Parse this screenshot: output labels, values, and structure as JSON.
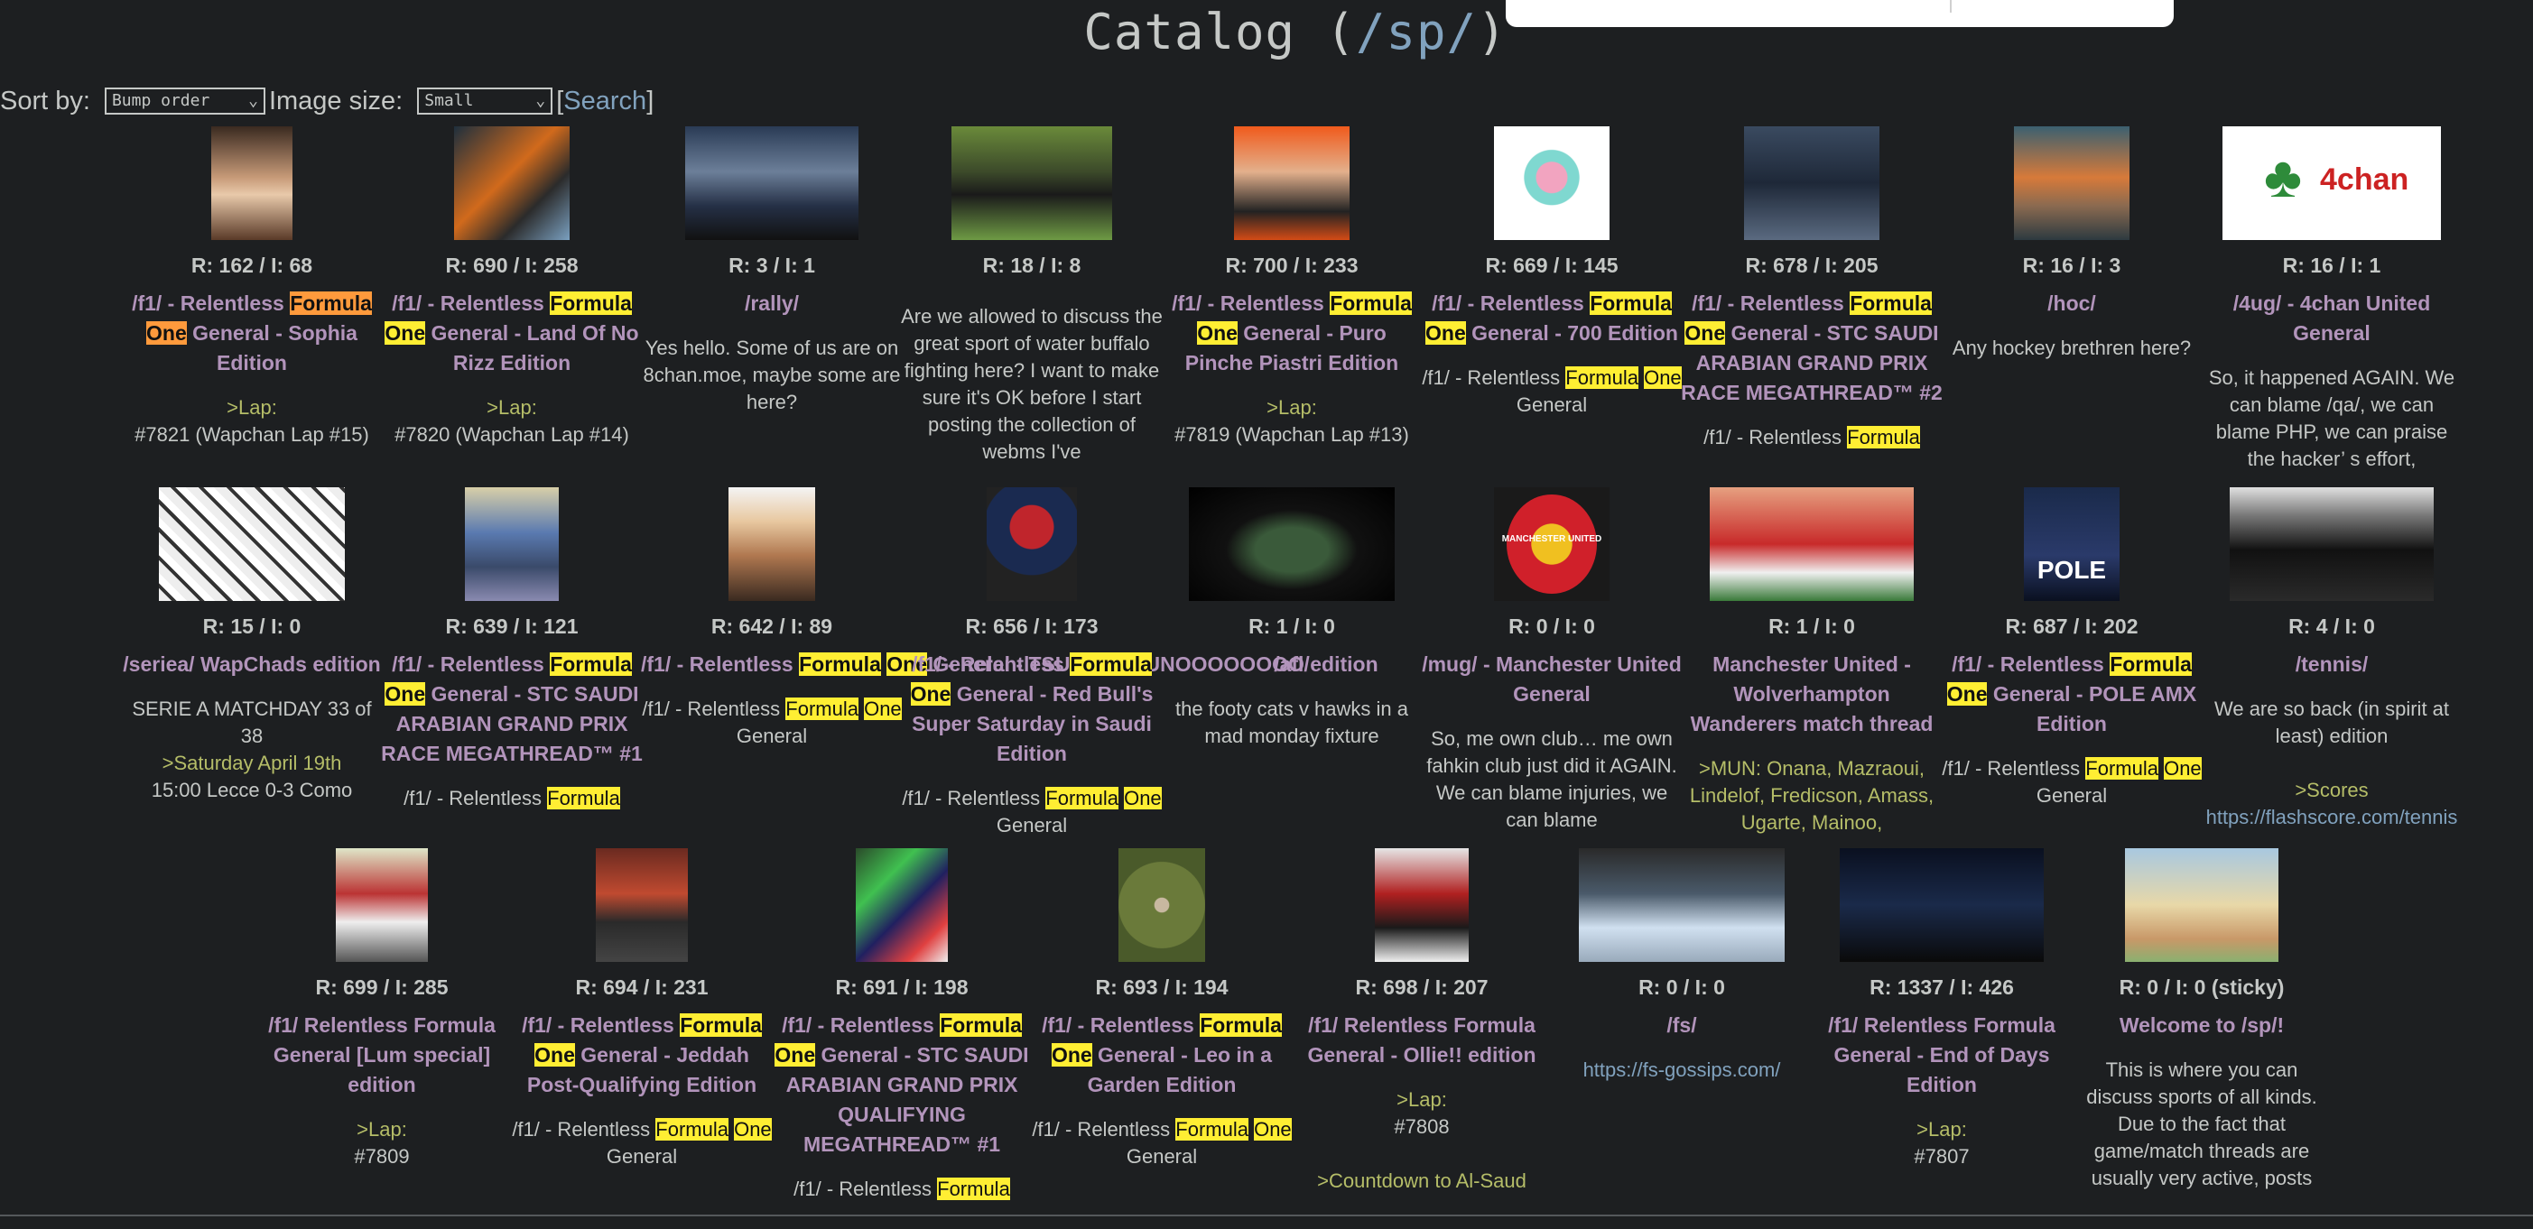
{
  "page": {
    "title_prefix": "Catalog (",
    "board": "/sp/",
    "title_suffix": ")"
  },
  "controls": {
    "sort_label": "Sort by:",
    "sort_value": "Bump order",
    "size_label": "Image size:",
    "size_value": "Small",
    "search_open": "[",
    "search_label": "Search",
    "search_close": "]"
  },
  "threads": [
    {
      "stats": "R: 162 / I: 68",
      "pre": "/f1/ - Relentless ",
      "hl1": "Formula",
      "mid": " ",
      "hl2": "One",
      "post": " General - Sophia Edition",
      "body": "",
      "body_green": ">Lap:",
      "body2": "#7821 (Wapchan Lap #15)",
      "hlcolor": "orange"
    },
    {
      "stats": "R: 690 / I: 258",
      "pre": "/f1/ - Relentless ",
      "hl1": "Formula",
      "mid": " ",
      "hl2": "One",
      "post": " General - Land Of No Rizz Edition",
      "body": "",
      "body_green": ">Lap:",
      "body2": "#7820 (Wapchan Lap #14)"
    },
    {
      "stats": "R: 3 / I: 1",
      "pre": "/rally/",
      "hl1": "",
      "mid": "",
      "hl2": "",
      "post": "",
      "body": "Yes hello. Some of us are on 8chan.moe, maybe some are here?",
      "body_green": "",
      "body2": ""
    },
    {
      "stats": "R: 18 / I: 8",
      "pre": "",
      "hl1": "",
      "mid": "",
      "hl2": "",
      "post": "",
      "body": "Are we allowed to discuss the great sport of water buffalo fighting here? I want to make sure it's OK before I start posting the collection of webms I've",
      "body_green": "",
      "body2": ""
    },
    {
      "stats": "R: 700 / I: 233",
      "pre": "/f1/ - Relentless ",
      "hl1": "Formula",
      "mid": " ",
      "hl2": "One",
      "post": " General - Puro Pinche Piastri Edition",
      "body": "",
      "body_green": ">Lap:",
      "body2": "#7819 (Wapchan Lap #13)"
    },
    {
      "stats": "R: 669 / I: 145",
      "pre": "/f1/ - Relentless ",
      "hl1": "Formula",
      "mid": " ",
      "hl2": "One",
      "post": " General - 700 Edition",
      "body": "/f1/ - Relentless ",
      "bhl1": "Formula",
      "bhl2": "One",
      "bpost": " General"
    },
    {
      "stats": "R: 678 / I: 205",
      "pre": "/f1/ - Relentless ",
      "hl1": "Formula",
      "mid": " ",
      "hl2": "One",
      "post": " General - STC SAUDI ARABIAN GRAND PRIX RACE MEGATHREAD™ #2",
      "body": "/f1/ - Relentless ",
      "bhl1": "Formula",
      "bhl2": "",
      "bpost": ""
    },
    {
      "stats": "R: 16 / I: 3",
      "pre": "/hoc/",
      "hl1": "",
      "mid": "",
      "hl2": "",
      "post": "",
      "body": "Any hockey brethren here?",
      "body_green": "",
      "body2": ""
    },
    {
      "stats": "R: 16 / I: 1",
      "pre": "/4ug/ - 4chan United General",
      "hl1": "",
      "mid": "",
      "hl2": "",
      "post": "",
      "body": "So, it happened AGAIN. We can blame /qa/, we can blame PHP, we can praise the hacker’ s effort,",
      "body_green": "",
      "body2": ""
    },
    {
      "stats": "R: 15 / I: 0",
      "pre": "/seriea/ WapChads edition",
      "hl1": "",
      "mid": "",
      "hl2": "",
      "post": "",
      "body": "SERIE A MATCHDAY 33 of 38",
      "body_green": ">Saturday April 19th",
      "body2": "15:00 Lecce 0-3 Como"
    },
    {
      "stats": "R: 639 / I: 121",
      "pre": "/f1/ - Relentless ",
      "hl1": "Formula",
      "mid": " ",
      "hl2": "One",
      "post": " General - STC SAUDI ARABIAN GRAND PRIX RACE MEGATHREAD™ #1",
      "body": "/f1/ - Relentless ",
      "bhl1": "Formula",
      "bhl2": "",
      "bpost": ""
    },
    {
      "stats": "R: 642 / I: 89",
      "pre": "/f1/ - Relentless ",
      "hl1": "Formula",
      "mid": " ",
      "hl2": "One",
      "post": " General - TSUUUUUUUNOOOOOOOO edition",
      "body": "/f1/ - Relentless ",
      "bhl1": "Formula",
      "bhl2": "One",
      "bpost": " General"
    },
    {
      "stats": "R: 656 / I: 173",
      "pre": "/f1/ - Relentless ",
      "hl1": "Formula",
      "mid": " ",
      "hl2": "One",
      "post": " General - Red Bull's Super Saturday in Saudi Edition",
      "body": "/f1/ - Relentless ",
      "bhl1": "Formula",
      "bhl2": "One",
      "bpost": " General"
    },
    {
      "stats": "R: 1 / I: 0",
      "pre": "/afl/",
      "hl1": "",
      "mid": "",
      "hl2": "",
      "post": "",
      "body": "the footy cats v hawks in a mad monday fixture",
      "body_green": "",
      "body2": ""
    },
    {
      "stats": "R: 0 / I: 0",
      "pre": "/mug/ - Manchester United General",
      "hl1": "",
      "mid": "",
      "hl2": "",
      "post": "",
      "body": "So, me own club… me own fahkin club just did it AGAIN. We can blame injuries, we can blame",
      "body_green": "",
      "body2": ""
    },
    {
      "stats": "R: 1 / I: 0",
      "pre": "Manchester United - Wolverhampton Wanderers match thread",
      "hl1": "",
      "mid": "",
      "hl2": "",
      "post": "",
      "body": "",
      "body_green": ">MUN: Onana, Mazraoui, Lindelof, Fredicson, Amass, Ugarte, Mainoo,",
      "body2": ""
    },
    {
      "stats": "R: 687 / I: 202",
      "pre": "/f1/ - Relentless ",
      "hl1": "Formula",
      "mid": " ",
      "hl2": "One",
      "post": " General - POLE AMX Edition",
      "body": "/f1/ - Relentless ",
      "bhl1": "Formula",
      "bhl2": "One",
      "bpost": " General"
    },
    {
      "stats": "R: 4 / I: 0",
      "pre": "/tennis/",
      "hl1": "",
      "mid": "",
      "hl2": "",
      "post": "",
      "body": "We are so back (in spirit at least) edition",
      "body_green": ">Scores",
      "body2": "",
      "link": "https://flashscore.com/tennis"
    },
    {
      "stats": "R: 699 / I: 285",
      "pre": "/f1/ Relentless Formula General [Lum special] edition",
      "hl1": "",
      "mid": "",
      "hl2": "",
      "post": "",
      "body": "",
      "body_green": ">Lap:",
      "body2": "#7809"
    },
    {
      "stats": "R: 694 / I: 231",
      "pre": "/f1/ - Relentless ",
      "hl1": "Formula",
      "mid": " ",
      "hl2": "One",
      "post": " General - Jeddah Post-Qualifying Edition",
      "body": "/f1/ - Relentless ",
      "bhl1": "Formula",
      "bhl2": "One",
      "bpost": " General"
    },
    {
      "stats": "R: 691 / I: 198",
      "pre": "/f1/ - Relentless ",
      "hl1": "Formula",
      "mid": " ",
      "hl2": "One",
      "post": " General - STC SAUDI ARABIAN GRAND PRIX QUALIFYING MEGATHREAD™ #1",
      "body": "/f1/ - Relentless ",
      "bhl1": "Formula",
      "bhl2": "",
      "bpost": ""
    },
    {
      "stats": "R: 693 / I: 194",
      "pre": "/f1/ - Relentless ",
      "hl1": "Formula",
      "mid": " ",
      "hl2": "One",
      "post": " General - Leo in a Garden Edition",
      "body": "/f1/ - Relentless ",
      "bhl1": "Formula",
      "bhl2": "One",
      "bpost": " General"
    },
    {
      "stats": "R: 698 / I: 207",
      "pre": "/f1/ Relentless Formula General - Ollie!! edition",
      "hl1": "",
      "mid": "",
      "hl2": "",
      "post": "",
      "body": "",
      "body_green": ">Lap:",
      "body2": "#7808",
      "body_green2": ">Countdown to Al-Saud"
    },
    {
      "stats": "R: 0 / I: 0",
      "pre": "/fs/",
      "hl1": "",
      "mid": "",
      "hl2": "",
      "post": "",
      "body": "",
      "body_green": "",
      "body2": "",
      "link": "https://fs-gossips.com/"
    },
    {
      "stats": "R: 1337 / I: 426",
      "pre": "/f1/ Relentless Formula General - End of Days Edition",
      "hl1": "",
      "mid": "",
      "hl2": "",
      "post": "",
      "body": "",
      "body_green": ">Lap:",
      "body2": "#7807"
    },
    {
      "stats": "R: 0 / I: 0 (sticky)",
      "pre": "Welcome to /sp/!",
      "hl1": "",
      "mid": "",
      "hl2": "",
      "post": "",
      "body": "This is where you can discuss sports of all kinds. Due to the fact that game/match threads are usually very active, posts",
      "body_green": "",
      "body2": ""
    }
  ],
  "thumbs": {
    "t4chan_text": "4chan",
    "pole_text": "POLE",
    "mu_text": "MANCHESTER UNITED"
  }
}
